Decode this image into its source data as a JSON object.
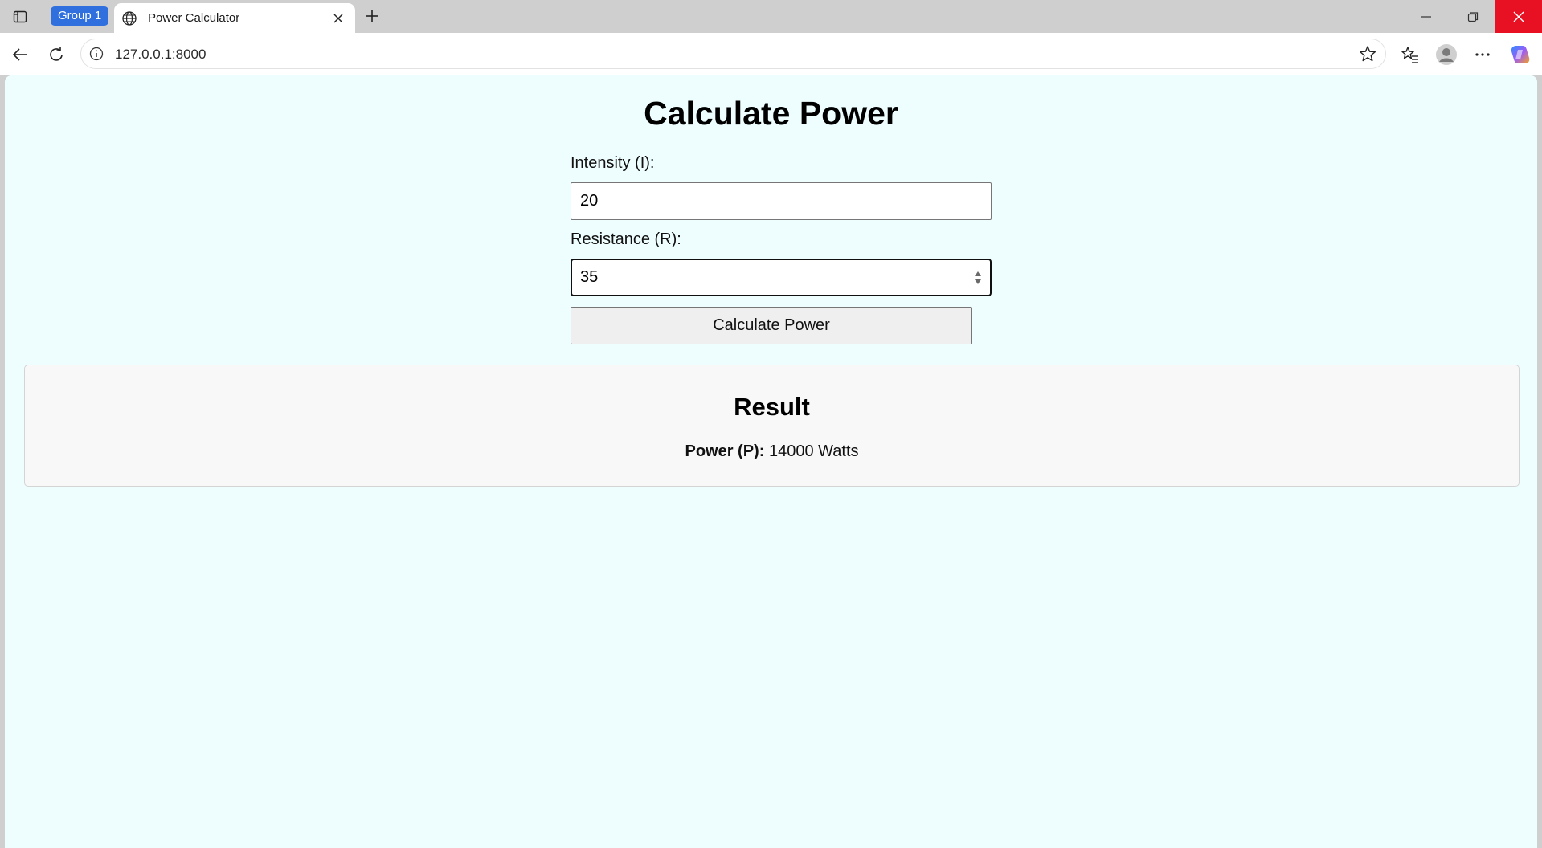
{
  "browser": {
    "tab_group_label": "Group 1",
    "tab_title": "Power Calculator",
    "url": "127.0.0.1:8000",
    "close_button_color": "#e81123",
    "group_color": "#2f6fde"
  },
  "page": {
    "background_color": "#eefefe",
    "title": "Calculate Power",
    "form": {
      "intensity_label": "Intensity (I):",
      "intensity_value": "20",
      "resistance_label": "Resistance (R):",
      "resistance_value": "35",
      "submit_label": "Calculate Power"
    },
    "result": {
      "title": "Result",
      "power_label": "Power (P):",
      "power_value": "14000 Watts"
    }
  },
  "icons": {
    "tab_actions": "tab-actions-icon",
    "favicon": "globe-icon",
    "tab_close": "close-icon",
    "new_tab": "plus-icon",
    "back": "arrow-left-icon",
    "reload": "reload-icon",
    "site_info": "info-icon",
    "favorite": "star-icon",
    "favorites_list": "favorites-icon",
    "profile": "avatar-icon",
    "menu": "more-icon",
    "copilot": "copilot-icon"
  }
}
